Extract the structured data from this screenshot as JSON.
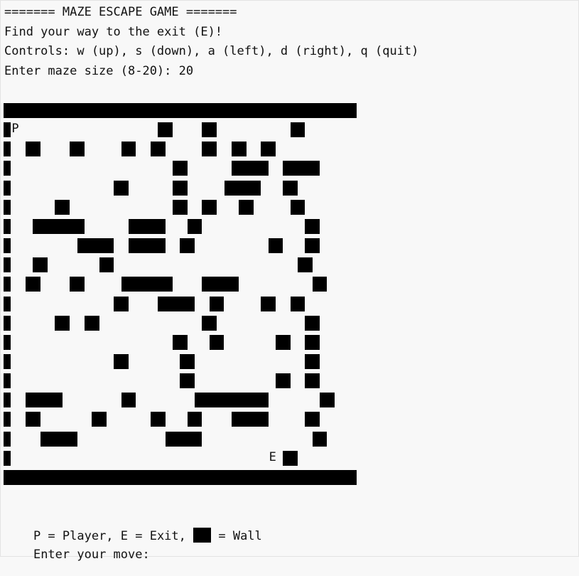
{
  "console": {
    "title_line": "======= MAZE ESCAPE GAME =======",
    "instruction_line": "Find your way to the exit (E)!",
    "controls_line": "Controls: w (up), s (down), a (left), d (right), q (quit)",
    "size_prompt_line": "Enter maze size (8-20): 20",
    "legend_prefix": "P = Player, E = Exit, ",
    "legend_suffix": " = Wall",
    "move_prompt_line": "Enter your move:"
  },
  "maze": {
    "size": 20,
    "player_symbol": "P",
    "exit_symbol": "E",
    "grid": [
      "################################################",
      "#P                   ##    ##          ##       ",
      "#  ##    ##     ##  ##     ##  ##  ##           ",
      "#                      ##      #####  #####     ",
      "#              ##      ##     #####   ##        ",
      "#      ##              ##  ##   ##     ##       ",
      "#   #######      #####   ##              ##     ",
      "#         #####  #####  ##          ##   ##     ",
      "#   ##       ##                         ##      ",
      "#  ##    ##     #######    #####          ##    ",
      "#              ##    #####  ##     ##  ##       ",
      "#      ##  ##              ##            ##     ",
      "#                      ##   ##       ##  ##     ",
      "#              ##       ##               ##     ",
      "#                       ##           ##  ##     ",
      "#  #####        ##        ##########       ##    ",
      "#  ##       ##      ##   ##    #####     ##     ",
      "#    #####            #####               ##    ",
      "#                                   E ##        ",
      "################################################"
    ]
  }
}
